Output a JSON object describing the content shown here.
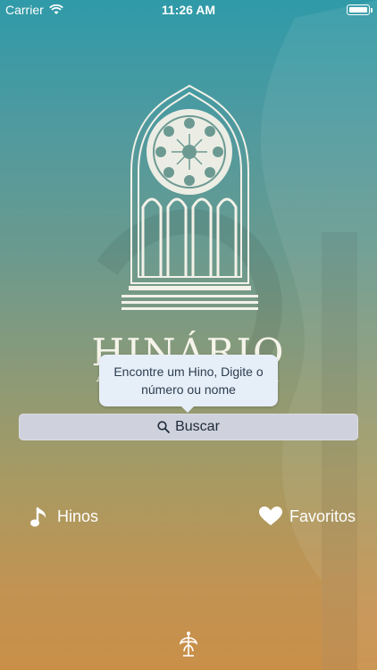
{
  "status_bar": {
    "carrier": "Carrier",
    "time": "11:26 AM"
  },
  "app": {
    "title": "HINÁRIO",
    "subtitle_left": "A",
    "subtitle_right": "A"
  },
  "tooltip": {
    "text": "Encontre um Hino, Digite o número ou nome"
  },
  "search": {
    "label": "Buscar",
    "icon": "search-icon"
  },
  "nav": {
    "hinos": {
      "label": "Hinos",
      "icon": "music-note-icon"
    },
    "favoritos": {
      "label": "Favoritos",
      "icon": "heart-icon"
    }
  },
  "colors": {
    "gradient_top": "#2f9aa8",
    "gradient_bottom": "#c98f48",
    "button_bg": "#cfd2dc",
    "tooltip_bg": "#e6eef8"
  }
}
